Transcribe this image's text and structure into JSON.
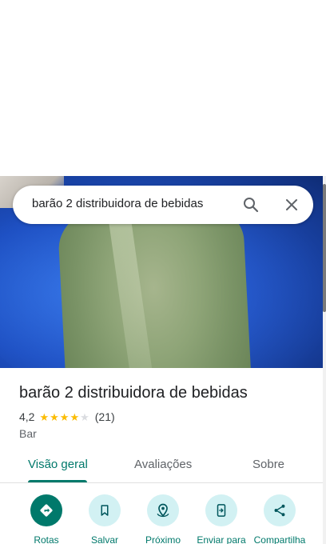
{
  "search": {
    "query": "barão 2 distribuidora de bebidas",
    "search_icon": "search-icon",
    "close_icon": "close-icon"
  },
  "place": {
    "name": "barão 2 distribuidora de bebidas",
    "rating": "4,2",
    "rating_value": 4.2,
    "stars_max": 5,
    "review_count": "(21)",
    "category": "Bar"
  },
  "tabs": [
    {
      "label": "Visão geral",
      "active": true
    },
    {
      "label": "Avaliações",
      "active": false
    },
    {
      "label": "Sobre",
      "active": false
    }
  ],
  "actions": [
    {
      "label": "Rotas",
      "icon": "directions-icon"
    },
    {
      "label": "Salvar",
      "icon": "bookmark-icon"
    },
    {
      "label": "Próximo",
      "icon": "nearby-icon"
    },
    {
      "label": "Enviar para",
      "icon": "send-to-phone-icon"
    },
    {
      "label": "Compartilha",
      "icon": "share-icon"
    }
  ],
  "colors": {
    "accent": "#00796b",
    "action_bg": "#d2f1f3",
    "star": "#fbbc04"
  }
}
